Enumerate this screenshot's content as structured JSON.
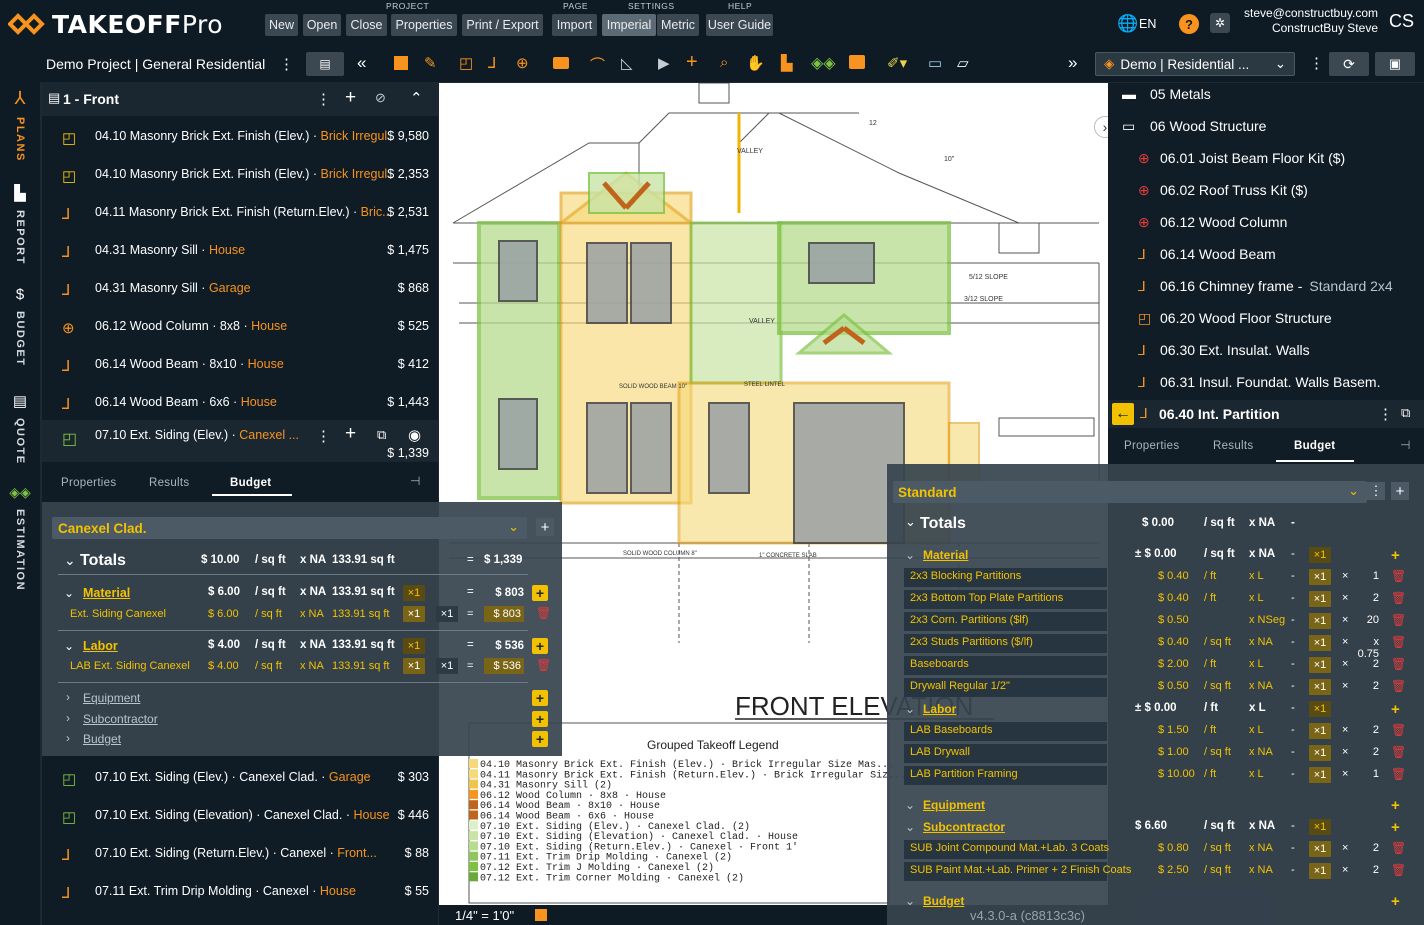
{
  "app": {
    "logo": "TAKEOFF",
    "logo_pro": "Pro"
  },
  "menu": {
    "project_label": "PROJECT",
    "page_label": "PAGE",
    "settings_label": "SETTINGS",
    "help_label": "HELP",
    "new": "New",
    "open": "Open",
    "close": "Close",
    "properties": "Properties",
    "print_export": "Print / Export",
    "import": "Import",
    "imperial": "Imperial",
    "metric": "Metric",
    "user_guide": "User Guide"
  },
  "user": {
    "lang": "EN",
    "email": "steve@constructbuy.com",
    "name": "ConstructBuy Steve",
    "initials": "CS"
  },
  "toolbar": {
    "project_title": "Demo Project | General Residential",
    "template_select": "Demo | Residential ..."
  },
  "rail": {
    "plans": "PLANS",
    "report": "REPORT",
    "budget": "BUDGET",
    "quote": "QUOTE",
    "estimation": "ESTIMATION"
  },
  "left": {
    "page_title": "1 - Front",
    "items": [
      {
        "name": "04.10 Masonry Brick Ext. Finish (Elev.)",
        "sub": "Brick Irregul...",
        "price": "$ 9,580",
        "icon": "area-icon"
      },
      {
        "name": "04.10 Masonry Brick Ext. Finish (Elev.)",
        "sub": "Brick Irregul...",
        "price": "$ 2,353",
        "icon": "area-icon"
      },
      {
        "name": "04.11 Masonry Brick Ext. Finish (Return.Elev.)",
        "sub": "Bric...",
        "price": "$ 2,531",
        "icon": "linear-icon"
      },
      {
        "name": "04.31 Masonry Sill",
        "sub": "House",
        "price": "$ 1,475",
        "icon": "linear-icon"
      },
      {
        "name": "04.31 Masonry Sill",
        "sub": "Garage",
        "price": "$ 868",
        "icon": "linear-icon"
      },
      {
        "name": "06.12 Wood Column",
        "sub": "8x8",
        "sub2": "House",
        "price": "$ 525",
        "icon": "count-icon"
      },
      {
        "name": "06.14 Wood Beam",
        "sub": "8x10",
        "sub2": "House",
        "price": "$ 412",
        "icon": "linear-icon"
      },
      {
        "name": "06.14 Wood Beam",
        "sub": "6x6",
        "sub2": "House",
        "price": "$ 1,443",
        "icon": "linear-icon"
      }
    ],
    "selected": {
      "name": "07.10 Ext. Siding (Elev.)",
      "sub": "Canexel ...",
      "price": "$ 1,339"
    },
    "tabs": {
      "properties": "Properties",
      "results": "Results",
      "budget": "Budget"
    },
    "items2": [
      {
        "name": "07.10 Ext. Siding (Elev.)",
        "sub": "Canexel Clad.",
        "sub2": "Garage",
        "price": "$ 303"
      },
      {
        "name": "07.10 Ext. Siding (Elevation)",
        "sub": "Canexel Clad.",
        "sub2": "House",
        "price": "$ 446"
      },
      {
        "name": "07.10 Ext. Siding (Return.Elev.)",
        "sub": "Canexel",
        "sub2": "Front...",
        "price": "$ 88"
      },
      {
        "name": "07.11 Ext. Trim Drip Molding",
        "sub": "Canexel",
        "sub2": "House",
        "price": "$ 55"
      }
    ]
  },
  "budget_left": {
    "select": "Canexel Clad.",
    "totals": "Totals",
    "totals_rate": "$ 10.00",
    "totals_unit": "/ sq ft",
    "totals_na": "x NA",
    "totals_qty": "133.91 sq ft",
    "totals_eq": "=",
    "totals_sum": "$ 1,339",
    "material": "Material",
    "mat_rate": "$ 6.00",
    "mat_unit": "/ sq ft",
    "mat_na": "x NA",
    "mat_qty": "133.91 sq ft",
    "mat_x": "×1",
    "mat_sum": "$ 803",
    "mat_item": "Ext. Siding Canexel",
    "mat_item_rate": "$ 6.00",
    "mat_item_unit": "/ sq ft",
    "mat_item_na": "x NA",
    "mat_item_qty": "133.91 sq ft",
    "mat_item_x": "×1",
    "mat_item_x2": "×1",
    "mat_item_sum": "$ 803",
    "labor": "Labor",
    "lab_rate": "$ 4.00",
    "lab_unit": "/ sq ft",
    "lab_na": "x NA",
    "lab_qty": "133.91 sq ft",
    "lab_x": "×1",
    "lab_sum": "$ 536",
    "lab_item": "LAB Ext. Siding Canexel",
    "lab_item_rate": "$ 4.00",
    "lab_item_unit": "/ sq ft",
    "lab_item_na": "x NA",
    "lab_item_qty": "133.91 sq ft",
    "lab_item_x": "×1",
    "lab_item_x2": "×1",
    "lab_item_sum": "$ 536",
    "equipment": "Equipment",
    "subcontractor": "Subcontractor",
    "budget": "Budget"
  },
  "drawing": {
    "title": "FRONT ELEVATION",
    "scale": "1/4\" = 1'0\"",
    "legend_title": "Grouped Takeoff Legend",
    "legend": [
      "04.10 Masonry Brick Ext. Finish (Elev.) · Brick Irregular Size Mas...",
      "04.11 Masonry Brick Ext. Finish (Return.Elev.) · Brick Irregular Siz...",
      "04.31 Masonry Sill (2)",
      "06.12 Wood Column · 8x8 · House",
      "06.14 Wood Beam · 8x10 · House",
      "06.14 Wood Beam · 6x6 · House",
      "07.10 Ext. Siding (Elev.) · Canexel Clad. (2)",
      "07.10 Ext. Siding (Elevation) · Canexel Clad. · House",
      "07.10 Ext. Siding (Return.Elev.) · Canexel · Front 1'",
      "07.11 Ext. Trim Drip Molding · Canexel (2)",
      "07.12 Ext. Trim J Molding · Canexel (2)",
      "07.12 Ext. Trim Corner Molding · Canexel (2)"
    ],
    "labels": {
      "valley": "VALLEY",
      "valley2": "VALLEY",
      "slope1": "5/12 SLOPE",
      "slope2": "3/12 SLOPE",
      "beam": "SOLID WOOD BEAM 10\"",
      "lintel": "STEEL LINTEL",
      "column": "SOLID WOOD COLUMN 8\"",
      "slab": "1\" CONCRETE SLAB",
      "dim12": "12",
      "dim10": "10\""
    }
  },
  "right": {
    "tree": [
      {
        "label": "05 Metals",
        "type": "folder"
      },
      {
        "label": "06 Wood Structure",
        "type": "folder-open"
      },
      {
        "label": "06.01 Joist Beam Floor Kit ($)",
        "type": "count"
      },
      {
        "label": "06.02 Roof Truss Kit ($)",
        "type": "count"
      },
      {
        "label": "06.12 Wood Column",
        "type": "count"
      },
      {
        "label": "06.14 Wood Beam",
        "type": "linear"
      },
      {
        "label": "06.16 Chimney frame -",
        "sub": "Standard 2x4",
        "type": "linear"
      },
      {
        "label": "06.20 Wood Floor Structure",
        "type": "area"
      },
      {
        "label": "06.30 Ext. Insulat. Walls",
        "type": "linear"
      },
      {
        "label": "06.31 Insul. Foundat. Walls Basem.",
        "type": "linear"
      }
    ],
    "selected": "06.40 Int. Partition",
    "tabs": {
      "properties": "Properties",
      "results": "Results",
      "budget": "Budget"
    }
  },
  "budget_right": {
    "select": "Standard",
    "totals": "Totals",
    "totals_rate": "$ 0.00",
    "totals_unit": "/ sq ft",
    "totals_na": "x NA",
    "totals_dash": "-",
    "material": "Material",
    "mat_rate": "$ 0.00",
    "mat_unit": "/ sq ft",
    "mat_na": "x NA",
    "mat_items": [
      {
        "name": "2x3 Blocking Partitions",
        "rate": "$ 0.40",
        "unit": "/ ft",
        "na": "x L",
        "x": "×1",
        "mult": "1"
      },
      {
        "name": "2x3 Bottom Top Plate Partitions",
        "rate": "$ 0.40",
        "unit": "/ ft",
        "na": "x L",
        "x": "×1",
        "mult": "2"
      },
      {
        "name": "2x3 Corn. Partitions ($lf)",
        "rate": "$ 0.50",
        "unit": "",
        "na": "x NSeg",
        "x": "×1",
        "mult": "20"
      },
      {
        "name": "2x3 Studs Partitions ($/lf)",
        "rate": "$ 0.40",
        "unit": "/ sq ft",
        "na": "x NA",
        "x": "×1",
        "mult": "x 0.75"
      },
      {
        "name": "Baseboards",
        "rate": "$ 2.00",
        "unit": "/ ft",
        "na": "x L",
        "x": "×1",
        "mult": "2"
      },
      {
        "name": "Drywall Regular 1/2\"",
        "rate": "$ 0.50",
        "unit": "/ sq ft",
        "na": "x NA",
        "x": "×1",
        "mult": "2"
      }
    ],
    "labor": "Labor",
    "lab_rate": "$ 0.00",
    "lab_unit": "/ ft",
    "lab_na": "x L",
    "lab_items": [
      {
        "name": "LAB Baseboards",
        "rate": "$ 1.50",
        "unit": "/ ft",
        "na": "x L",
        "x": "×1",
        "mult": "2"
      },
      {
        "name": "LAB Drywall",
        "rate": "$ 1.00",
        "unit": "/ sq ft",
        "na": "x NA",
        "x": "×1",
        "mult": "2"
      },
      {
        "name": "LAB Partition Framing",
        "rate": "$ 10.00",
        "unit": "/ ft",
        "na": "x L",
        "x": "×1",
        "mult": "1"
      }
    ],
    "equipment": "Equipment",
    "subcontractor": "Subcontractor",
    "sub_rate": "$ 6.60",
    "sub_unit": "/ sq ft",
    "sub_na": "x NA",
    "sub_items": [
      {
        "name": "SUB Joint Compound Mat.+Lab. 3 Coats",
        "rate": "$ 0.80",
        "unit": "/ sq ft",
        "na": "x NA",
        "x": "×1",
        "mult": "2"
      },
      {
        "name": "SUB Paint Mat.+Lab. Primer + 2 Finish Coats",
        "rate": "$ 2.50",
        "unit": "/ sq ft",
        "na": "x NA",
        "x": "×1",
        "mult": "2"
      }
    ],
    "budget": "Budget",
    "version": "v4.3.0-a (c8813c3c)"
  },
  "colors": {
    "accent": "#f7931e",
    "yellow": "#f2c200",
    "bg": "#0f1b24",
    "panel": "#101c25",
    "green": "#7dc243"
  }
}
